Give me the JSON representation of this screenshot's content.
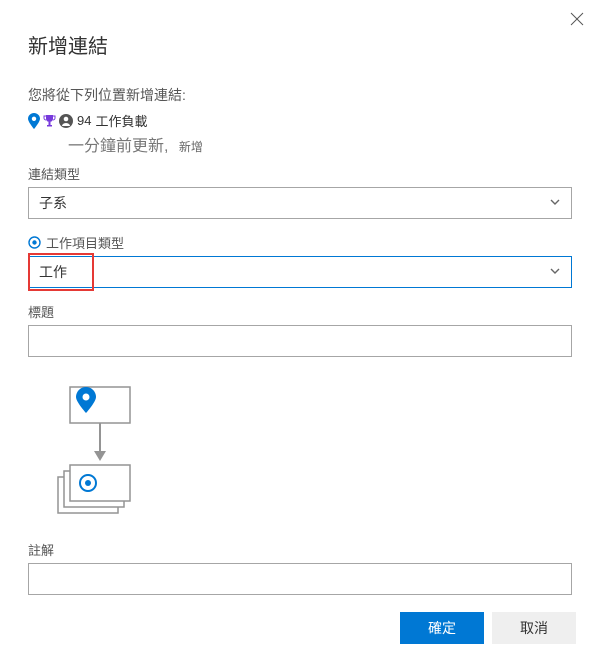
{
  "dialog": {
    "title": "新增連結",
    "instruction": "您將從下列位置新增連結:",
    "source_id": "94",
    "source_name": "工作負載",
    "updated_text": "一分鐘前更新,",
    "new_label": "新增"
  },
  "fields": {
    "link_type_label": "連結類型",
    "link_type_value": "子系",
    "work_item_type_label": "工作項目類型",
    "work_item_type_value": "工作",
    "title_label": "標題",
    "title_value": "",
    "comment_label": "註解",
    "comment_value": ""
  },
  "buttons": {
    "ok": "確定",
    "cancel": "取消"
  }
}
